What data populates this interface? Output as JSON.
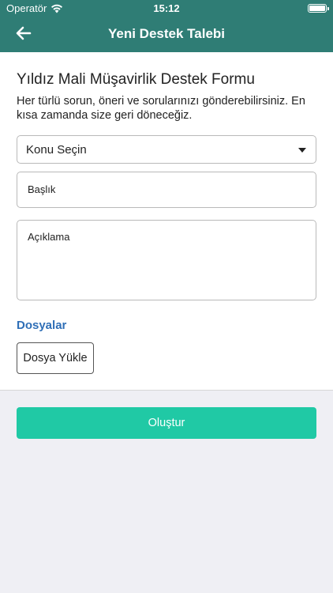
{
  "status_bar": {
    "carrier": "Operatör",
    "time": "15:12",
    "battery_level": 1.0
  },
  "nav": {
    "title": "Yeni Destek Talebi",
    "back_icon": "arrow-left-icon"
  },
  "form": {
    "title": "Yıldız Mali Müşavirlik Destek Formu",
    "description": "Her türlü sorun, öneri ve sorularınızı gönderebilirsiniz. En kısa zamanda size geri döneceğiz.",
    "subject_select": {
      "selected": "Konu Seçin"
    },
    "title_input": {
      "value": "",
      "placeholder": "Başlık"
    },
    "description_input": {
      "value": "",
      "placeholder": "Açıklama"
    },
    "files_section_title": "Dosyalar",
    "upload_label": "Dosya Yükle",
    "submit_label": "Oluştur"
  },
  "colors": {
    "header": "#2f7d75",
    "accent_link": "#2f6fb7",
    "submit": "#20c9a5",
    "background": "#efeff4"
  }
}
